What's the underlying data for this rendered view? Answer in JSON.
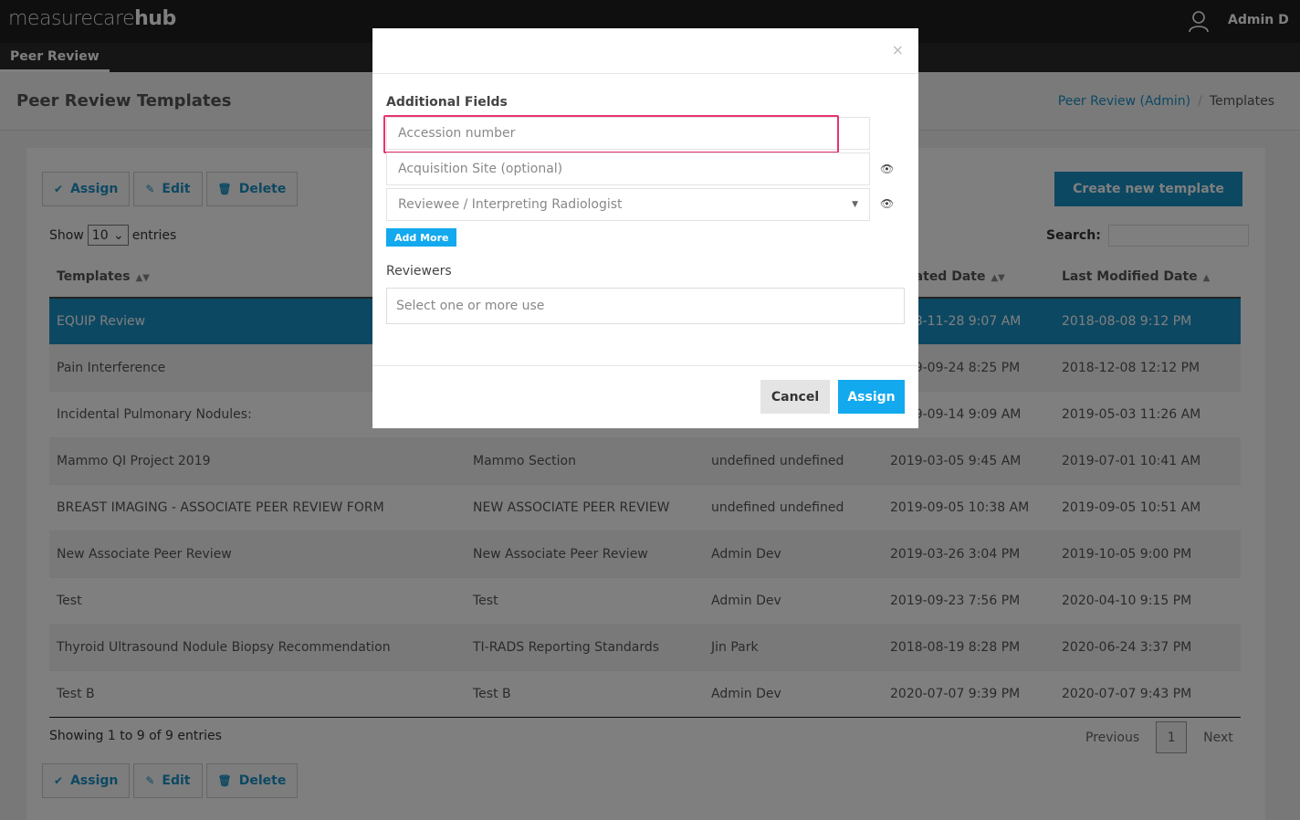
{
  "brand": {
    "thin": "measurecare",
    "bold": "hub"
  },
  "user": {
    "name": "Admin D"
  },
  "nav": {
    "tab": "Peer Review"
  },
  "header": {
    "title": "Peer Review Templates",
    "breadcrumb": {
      "parent": "Peer Review (Admin)",
      "separator": "/",
      "current": "Templates"
    }
  },
  "toolbar": {
    "assign": "Assign",
    "edit": "Edit",
    "delete": "Delete",
    "create": "Create new template"
  },
  "list": {
    "show_label": "Show",
    "entries_value": "10",
    "entries_label": "entries",
    "search_label": "Search:",
    "info": "Showing 1 to 9 of 9 entries",
    "prev": "Previous",
    "page": "1",
    "next": "Next"
  },
  "table": {
    "headers": [
      "Templates",
      "",
      "",
      "Created Date",
      "Last Modified Date"
    ],
    "rows": [
      [
        "EQUIP Review",
        "",
        "",
        "2018-11-28 9:07 AM",
        "2018-08-08 9:12 PM"
      ],
      [
        "Pain Interference",
        "",
        "",
        "2019-09-24 8:25 PM",
        "2018-12-08 12:12 PM"
      ],
      [
        "Incidental Pulmonary Nodules:",
        "",
        "",
        "2019-09-14 9:09 AM",
        "2019-05-03 11:26 AM"
      ],
      [
        "Mammo QI Project 2019",
        "Mammo Section",
        "undefined undefined",
        "2019-03-05 9:45 AM",
        "2019-07-01 10:41 AM"
      ],
      [
        "BREAST IMAGING - ASSOCIATE PEER REVIEW FORM",
        "NEW ASSOCIATE PEER REVIEW",
        "undefined undefined",
        "2019-09-05 10:38 AM",
        "2019-09-05 10:51 AM"
      ],
      [
        "New Associate Peer Review",
        "New Associate Peer Review",
        "Admin Dev",
        "2019-03-26 3:04 PM",
        "2019-10-05 9:00 PM"
      ],
      [
        "Test",
        "Test",
        "Admin Dev",
        "2019-09-23 7:56 PM",
        "2020-04-10 9:15 PM"
      ],
      [
        "Thyroid Ultrasound Nodule Biopsy Recommendation",
        "TI-RADS Reporting Standards",
        "Jin Park",
        "2018-08-19 8:28 PM",
        "2020-06-24 3:37 PM"
      ],
      [
        "Test B",
        "Test B",
        "Admin Dev",
        "2020-07-07 9:39 PM",
        "2020-07-07 9:43 PM"
      ]
    ]
  },
  "modal": {
    "close": "×",
    "additional_fields_label": "Additional Fields",
    "fields": {
      "accession": "Accession number",
      "acquisition": "Acquisition Site (optional)",
      "reviewee": "Reviewee / Interpreting Radiologist"
    },
    "add_more": "Add More",
    "reviewers_label": "Reviewers",
    "reviewers_placeholder": "Select one or more use",
    "cancel": "Cancel",
    "assign": "Assign"
  },
  "icons": {
    "user": "user-icon",
    "eye": "eye-slash-icon",
    "check": "check-circle-icon",
    "edit": "pencil-icon",
    "delete": "trash-icon"
  },
  "colors": {
    "accent": "#1a91c4",
    "modal_button": "#13a9ee",
    "highlight": "#e8336e"
  }
}
